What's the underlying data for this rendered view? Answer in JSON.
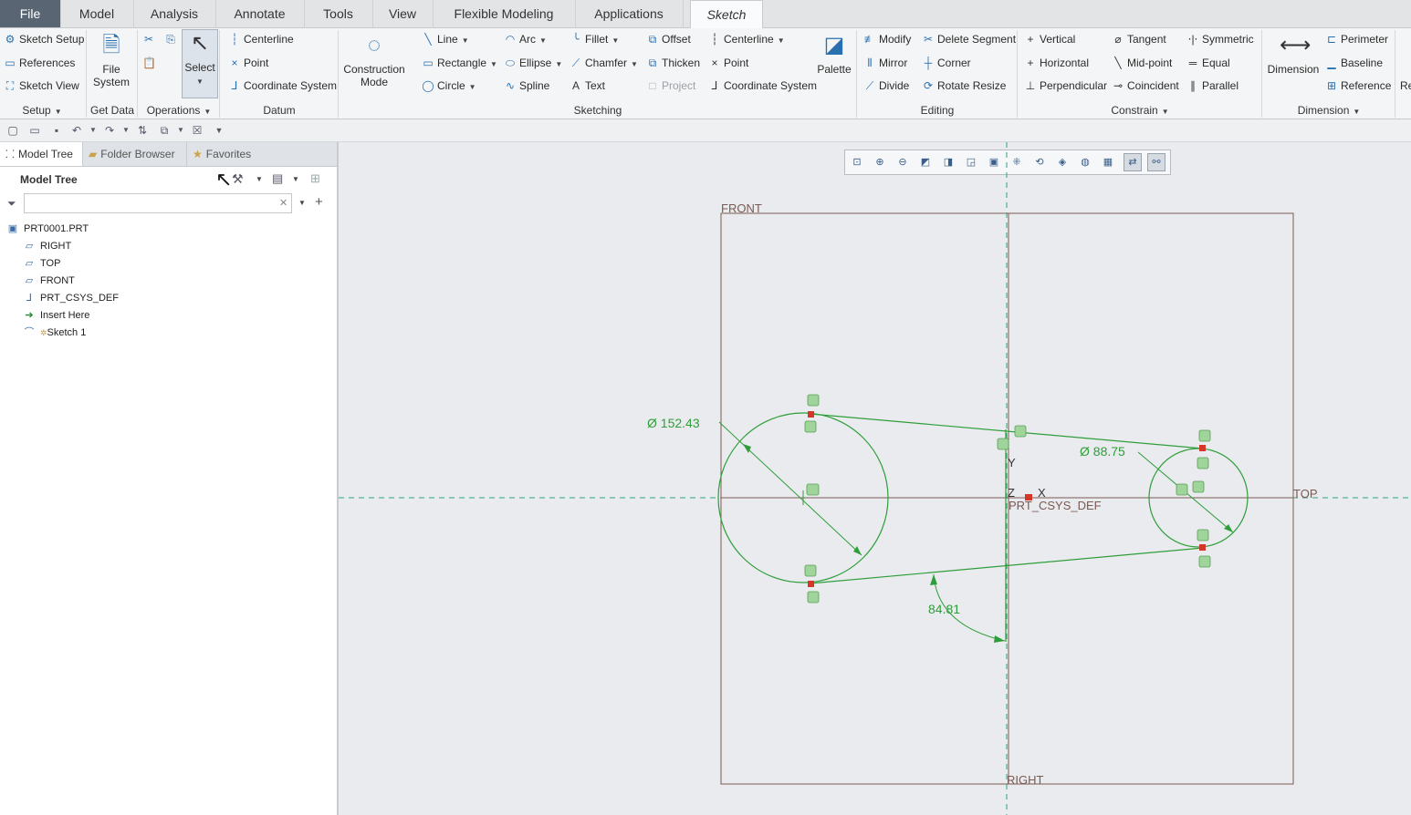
{
  "tabs": [
    "File",
    "Model",
    "Analysis",
    "Annotate",
    "Tools",
    "View",
    "Flexible Modeling",
    "Applications",
    "Sketch"
  ],
  "ribbon": {
    "setup": {
      "items": [
        "Sketch Setup",
        "References",
        "Sketch View"
      ],
      "label": "Setup"
    },
    "getdata": {
      "file_system": "File System",
      "label": "Get Data"
    },
    "operations": {
      "select": "Select",
      "label": "Operations"
    },
    "datum": {
      "items": [
        "Centerline",
        "Point",
        "Coordinate System"
      ],
      "label": "Datum"
    },
    "construction": "Construction Mode",
    "sketching": {
      "col1": [
        "Line",
        "Rectangle",
        "Circle"
      ],
      "col2": [
        "Arc",
        "Ellipse",
        "Spline"
      ],
      "col3": [
        "Fillet",
        "Chamfer",
        "Text"
      ],
      "col4": [
        "Offset",
        "Thicken",
        "Project"
      ],
      "col5": [
        "Centerline",
        "Point",
        "Coordinate System"
      ],
      "palette": "Palette",
      "label": "Sketching"
    },
    "editing": {
      "col1": [
        "Modify",
        "Mirror",
        "Divide"
      ],
      "col2": [
        "Delete Segment",
        "Corner",
        "Rotate Resize"
      ],
      "label": "Editing"
    },
    "constrain": {
      "col1": [
        "Vertical",
        "Horizontal",
        "Perpendicular"
      ],
      "col2": [
        "Tangent",
        "Mid-point",
        "Coincident"
      ],
      "col3": [
        "Symmetric",
        "Equal",
        "Parallel"
      ],
      "label": "Constrain"
    },
    "dimension": {
      "big": "Dimension",
      "items": [
        "Perimeter",
        "Baseline",
        "Reference"
      ],
      "label": "Dimension",
      "cut": "Re"
    }
  },
  "panel": {
    "tabs": [
      "Model Tree",
      "Folder Browser",
      "Favorites"
    ],
    "title": "Model Tree",
    "search_placeholder": "",
    "tree": [
      "PRT0001.PRT",
      "RIGHT",
      "TOP",
      "FRONT",
      "PRT_CSYS_DEF",
      "Insert Here",
      "Sketch 1"
    ]
  },
  "sketch": {
    "labels": {
      "front": "FRONT",
      "top": "TOP",
      "right": "RIGHT",
      "csys": "PRT_CSYS_DEF",
      "y": "Y",
      "z": "Z",
      "x": "X"
    },
    "dims": {
      "d1": "Ø 152.43",
      "d2": "Ø 88.75",
      "angle": "84.81"
    },
    "colors": {
      "sketch": "#2f9e3a",
      "datum": "#7a5a52",
      "axis": "#2aa57a",
      "weak": "#8fd08f"
    }
  }
}
